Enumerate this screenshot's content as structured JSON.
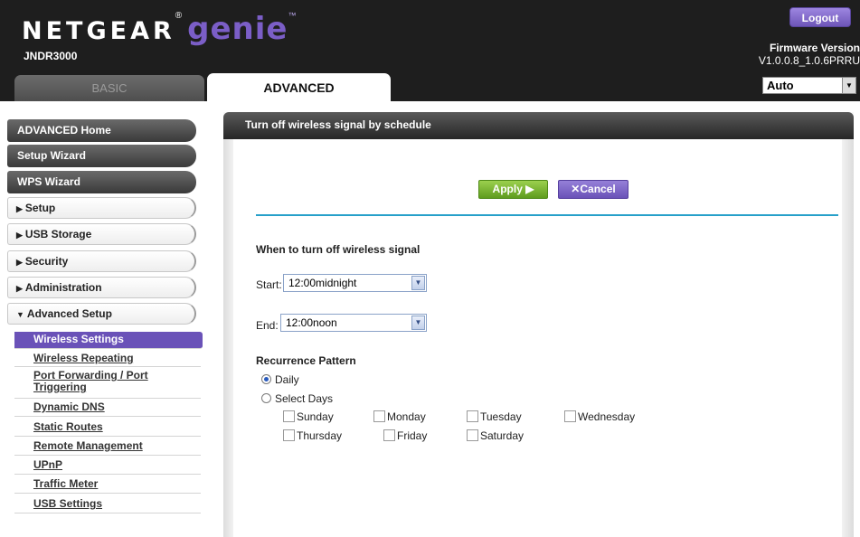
{
  "header": {
    "brand_netgear": "NETGEAR",
    "brand_genie": "genie",
    "model": "JNDR3000",
    "logout_label": "Logout",
    "firmware_label": "Firmware Version",
    "firmware_value": "V1.0.0.8_1.0.6PRRU",
    "tabs": [
      {
        "label": "BASIC",
        "active": false
      },
      {
        "label": "ADVANCED",
        "active": true
      }
    ],
    "language": "Auto"
  },
  "sidebar": {
    "top_buttons": [
      "ADVANCED Home",
      "Setup Wizard",
      "WPS Wizard"
    ],
    "sections": [
      {
        "label": "Setup",
        "expanded": false
      },
      {
        "label": "USB Storage",
        "expanded": false
      },
      {
        "label": "Security",
        "expanded": false
      },
      {
        "label": "Administration",
        "expanded": false
      },
      {
        "label": "Advanced Setup",
        "expanded": true
      }
    ],
    "submenu": [
      {
        "label": "Wireless Settings",
        "active": true
      },
      {
        "label": "Wireless Repeating",
        "active": false
      },
      {
        "label": "Port Forwarding / Port Triggering",
        "active": false
      },
      {
        "label": "Dynamic DNS",
        "active": false
      },
      {
        "label": "Static Routes",
        "active": false
      },
      {
        "label": "Remote Management",
        "active": false
      },
      {
        "label": "UPnP",
        "active": false
      },
      {
        "label": "Traffic Meter",
        "active": false
      },
      {
        "label": "USB Settings",
        "active": false
      }
    ]
  },
  "panel": {
    "title": "Turn off wireless signal by schedule",
    "apply_label": "Apply ▶",
    "cancel_label": "✕Cancel",
    "when_label": "When to turn off wireless signal",
    "start_label": "Start:",
    "start_value": "12:00midnight",
    "end_label": "End:",
    "end_value": "12:00noon",
    "recurrence_label": "Recurrence Pattern",
    "options": [
      {
        "label": "Daily",
        "checked": true
      },
      {
        "label": "Select Days",
        "checked": false
      }
    ],
    "days": [
      {
        "label": "Sunday",
        "checked": false
      },
      {
        "label": "Monday",
        "checked": false
      },
      {
        "label": "Tuesday",
        "checked": false
      },
      {
        "label": "Wednesday",
        "checked": false
      },
      {
        "label": "Thursday",
        "checked": false
      },
      {
        "label": "Friday",
        "checked": false
      },
      {
        "label": "Saturday",
        "checked": false
      }
    ]
  },
  "colors": {
    "header_bg": "#1e1e1e",
    "accent_purple": "#6a52b8",
    "apply_green": "#7bb536",
    "divider_blue": "#27a0c9"
  },
  "icons": {
    "dropdown": "chevron-down-icon",
    "collapsed": "triangle-right-icon",
    "expanded": "triangle-down-icon",
    "cancel": "x-icon",
    "apply": "play-icon"
  }
}
